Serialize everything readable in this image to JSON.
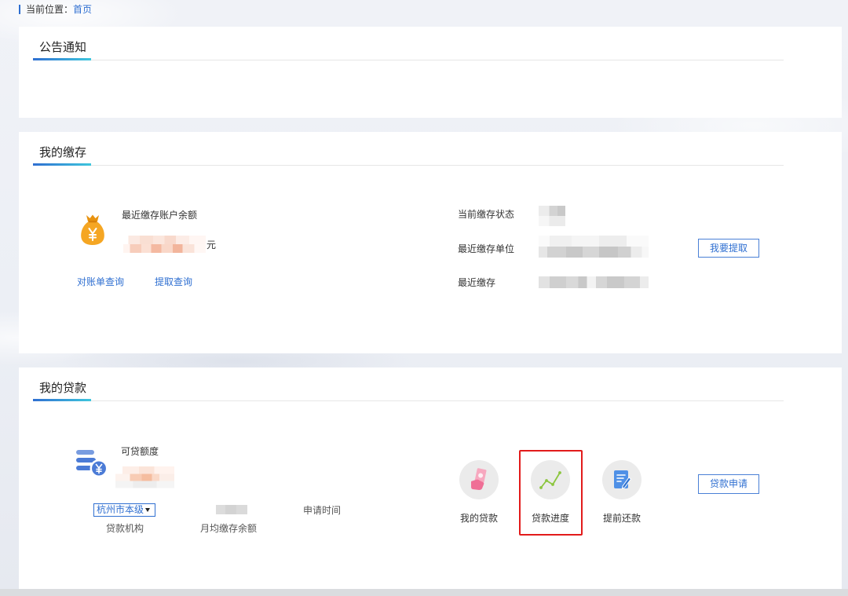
{
  "breadcrumb": {
    "prefix": "当前位置：",
    "current": "首页"
  },
  "notice_panel": {
    "title": "公告通知"
  },
  "deposit_panel": {
    "title": "我的缴存",
    "balance": {
      "label": "最近缴存账户余额",
      "unit": "元",
      "icon": "money-bag-icon"
    },
    "links": [
      {
        "label": "对账单查询"
      },
      {
        "label": "提取查询"
      }
    ],
    "details": [
      {
        "label": "当前缴存状态"
      },
      {
        "label": "最近缴存单位"
      },
      {
        "label": "最近缴存"
      }
    ],
    "withdraw_button": "我要提取"
  },
  "loan_panel": {
    "title": "我的贷款",
    "quota": {
      "label": "可贷额度",
      "icon": "coins-icon"
    },
    "institution": {
      "selected": "杭州市本级",
      "label": "贷款机构"
    },
    "avg_balance_label": "月均缴存余额",
    "apply_time_label": "申请时间",
    "actions": [
      {
        "label": "我的贷款",
        "icon": "money-hand-icon",
        "highlighted": false
      },
      {
        "label": "贷款进度",
        "icon": "line-chart-icon",
        "highlighted": true
      },
      {
        "label": "提前还款",
        "icon": "document-edit-icon",
        "highlighted": false
      }
    ],
    "apply_button": "贷款申请"
  },
  "colors": {
    "accent": "#2f6fd1",
    "accent_gradient_end": "#3ec6dd",
    "highlight": "#e21b1b",
    "money_bag": "#f5a623",
    "coins": "#4b7bd6",
    "chart_green": "#8cc63f",
    "hand_pink": "#ef6f96",
    "document_blue": "#4f90e6"
  }
}
